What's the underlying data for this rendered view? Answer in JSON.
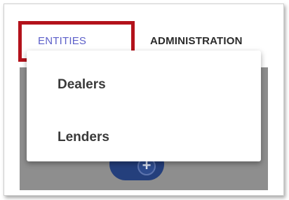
{
  "nav": {
    "tabs": [
      {
        "label": "ENTITIES"
      },
      {
        "label": "ADMINISTRATION"
      }
    ]
  },
  "dropdown": {
    "items": [
      {
        "label": "Dealers"
      },
      {
        "label": "Lenders"
      }
    ]
  },
  "fab": {
    "icon": "plus-icon",
    "glyph": "+",
    "color": "#243f7c"
  },
  "highlight": {
    "color": "#b3121b"
  },
  "colors": {
    "active_tab": "#5c5fc9",
    "tab_text": "#2b2b2b",
    "menu_text": "#3a3a3a",
    "content_overlay": "#8e8e8e"
  }
}
